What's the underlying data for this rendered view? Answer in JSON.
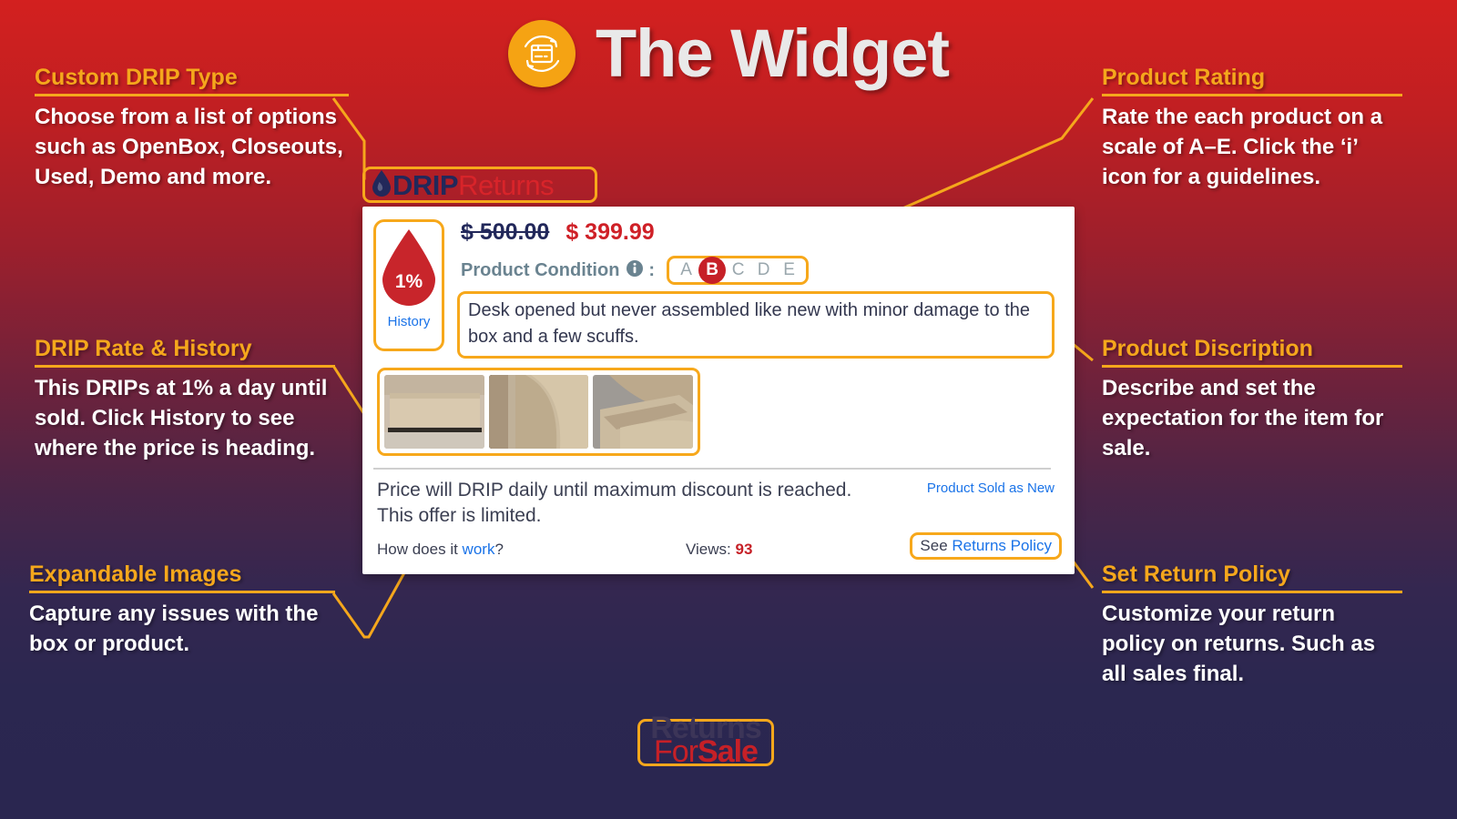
{
  "header": {
    "title": "The Widget",
    "logo_icon": "returns-box-circular-arrows-icon",
    "logo_color": "#f5a313"
  },
  "widget": {
    "brand": {
      "drip": "DRIP",
      "returns": "Returns",
      "drop_icon": "water-drop-icon"
    },
    "drip_rate": {
      "percent": "1%",
      "history_label": "History",
      "drop_icon": "water-drop-icon"
    },
    "price": {
      "original": "$ 500.00",
      "current": "$ 399.99"
    },
    "condition": {
      "label": "Product Condition",
      "info_icon": "info-circle-icon",
      "colon": ":",
      "grades": [
        "A",
        "B",
        "C",
        "D",
        "E"
      ],
      "selected": "B"
    },
    "description": "Desk opened but never assembled like new with minor damage to the box and a few scuffs.",
    "thumbnails": [
      {
        "alt": "desk-panel-in-box-photo"
      },
      {
        "alt": "box-corner-damage-photo"
      },
      {
        "alt": "scuffed-edge-photo"
      }
    ],
    "footer": {
      "note_line1": "Price will DRIP daily until maximum discount is reached.",
      "note_line2": "This offer is limited.",
      "sold_as_new": "Product Sold as New",
      "how_prefix": "How does it ",
      "how_link": "work",
      "how_suffix": "?",
      "views_label": "Views: ",
      "views_count": "93",
      "returns_prefix": "See ",
      "returns_link": "Returns Policy"
    }
  },
  "annotations": {
    "custom_drip_type": {
      "title": "Custom DRIP Type",
      "body": "Choose from a list of options such as OpenBox, Closeouts, Used, Demo and more."
    },
    "drip_rate_history": {
      "title": "DRIP Rate & History",
      "body": "This DRIPs at 1% a day until sold. Click History to see where the price is heading."
    },
    "expandable_images": {
      "title": "Expandable Images",
      "body": "Capture any issues with the box or product."
    },
    "product_rating": {
      "title": "Product Rating",
      "body": "Rate the each product on a scale of A–E. Click the ‘i’ icon for a guidelines."
    },
    "product_description": {
      "title": "Product Discription",
      "body": "Describe and set the expectation for the item for sale."
    },
    "set_return_policy": {
      "title": "Set Return Policy",
      "body": "Customize your return policy on returns. Such as all sales final."
    }
  },
  "brand_footer": {
    "returns": "Returns",
    "for": "For",
    "sale": "Sale"
  },
  "colors": {
    "accent_orange": "#f5a71c",
    "brand_red": "#c62027",
    "brand_navy": "#22285a",
    "link_blue": "#1a73e8"
  }
}
